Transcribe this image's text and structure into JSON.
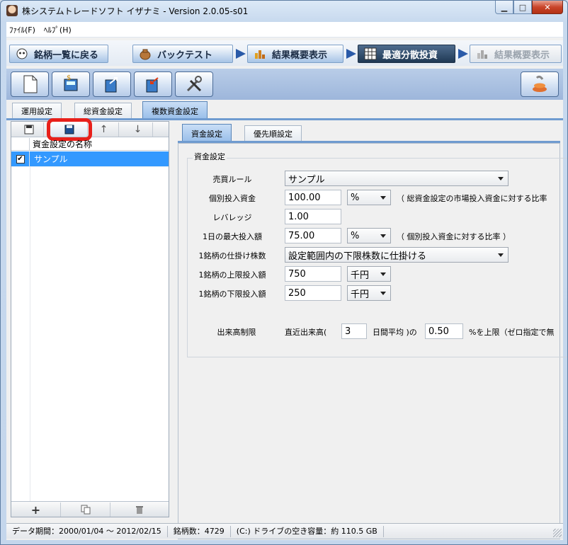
{
  "window": {
    "title": "株システムトレードソフト イザナミ - Version 2.0.05-s01",
    "minimize": "▁",
    "maximize": "□",
    "close": "✕"
  },
  "menu": {
    "file": "ﾌｧｲﾙ(F)",
    "help": "ﾍﾙﾌﾟ(H)"
  },
  "nav": {
    "back": "銘柄一覧に戻る",
    "backtest": "バックテスト",
    "summary1": "結果概要表示",
    "optimal": "最適分散投資",
    "summary2": "結果概要表示"
  },
  "settings_tabs": [
    "運用設定",
    "総資金設定",
    "複数資金設定"
  ],
  "list": {
    "header": "資金設定の名称",
    "items": [
      {
        "name": "サンプル",
        "checked": true
      }
    ],
    "check_mark": "✔"
  },
  "sub_tabs": [
    "資金設定",
    "優先順設定"
  ],
  "form": {
    "group_title": "資金設定",
    "trade_rule": {
      "label": "売買ルール",
      "value": "サンプル"
    },
    "individual": {
      "label": "個別投入資金",
      "value": "100.00",
      "unit": "%",
      "note": "（ 総資金設定の市場投入資金に対する比率"
    },
    "leverage": {
      "label": "レバレッジ",
      "value": "1.00"
    },
    "daily_max": {
      "label": "1日の最大投入額",
      "value": "75.00",
      "unit": "%",
      "note": "（ 個別投入資金に対する比率 ）"
    },
    "per_stock": {
      "label": "1銘柄の仕掛け株数",
      "value": "設定範囲内の下限株数に仕掛ける"
    },
    "upper": {
      "label": "1銘柄の上限投入額",
      "value": "750",
      "unit": "千円"
    },
    "lower": {
      "label": "1銘柄の下限投入額",
      "value": "250",
      "unit": "千円"
    },
    "volume": {
      "label": "出来高制限",
      "text1": "直近出来高(",
      "days": "3",
      "text2": "日間平均 )の",
      "ratio": "0.50",
      "text3": "%を上限（ゼロ指定で無"
    }
  },
  "status": {
    "period": "データ期間：2000/01/04 〜 2012/02/15",
    "count": "銘柄数：4729",
    "disk": "(C:) ドライブの空き容量：約 110.5 GB"
  },
  "colors": {
    "accent": "#3399ff",
    "highlight": "#e8201a",
    "active_nav": "#203954"
  }
}
